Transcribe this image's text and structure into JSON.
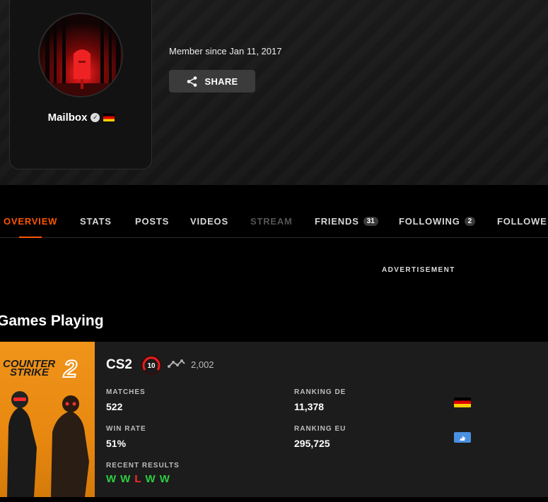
{
  "profile": {
    "username": "Mailbox",
    "member_since": "Member since Jan 11, 2017",
    "share_label": "SHARE",
    "country_icon": "flag-de-icon"
  },
  "tabs": [
    {
      "label": "OVERVIEW",
      "state": "active"
    },
    {
      "label": "STATS",
      "state": "normal"
    },
    {
      "label": "POSTS",
      "state": "normal"
    },
    {
      "label": "VIDEOS",
      "state": "normal"
    },
    {
      "label": "STREAM",
      "state": "disabled"
    },
    {
      "label": "FRIENDS",
      "count": "31",
      "state": "normal"
    },
    {
      "label": "FOLLOWING",
      "count": "2",
      "state": "normal"
    },
    {
      "label": "FOLLOWE",
      "state": "normal"
    }
  ],
  "advertisement_label": "ADVERTISEMENT",
  "games_section": {
    "title": "Games Playing",
    "game": {
      "cover_title_line1": "COUNTER",
      "cover_title_line2": "STRIKE",
      "cover_number": "2",
      "name": "CS2",
      "level": "10",
      "elo": "2,002",
      "matches_label": "MATCHES",
      "matches_value": "522",
      "win_rate_label": "WIN RATE",
      "win_rate_value": "51%",
      "ranking_country_label": "RANKING DE",
      "ranking_country_value": "11,378",
      "ranking_region_label": "RANKING EU",
      "ranking_region_value": "295,725",
      "recent_results_label": "RECENT RESULTS",
      "recent_results": [
        "W",
        "W",
        "L",
        "W",
        "W"
      ]
    }
  },
  "colors": {
    "accent": "#ff5500",
    "win": "#2ecc40",
    "loss": "#ff2a2a",
    "level_red": "#e81e1e"
  }
}
